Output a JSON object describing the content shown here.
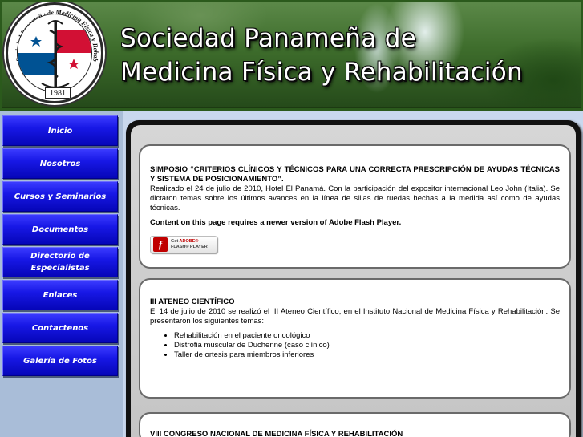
{
  "header": {
    "title_line1": "Sociedad Panameña de",
    "title_line2": "Medicina Física y Rehabilitación",
    "logo": {
      "ring_text": "Sociedad Panameña de Medicina Física y Rehabilitación",
      "year": "1981"
    }
  },
  "nav": {
    "items": [
      {
        "label": "Inicio"
      },
      {
        "label": "Nosotros"
      },
      {
        "label": "Cursos y Seminarios"
      },
      {
        "label": "Documentos"
      },
      {
        "label": "Directorio de Especialistas"
      },
      {
        "label": "Enlaces"
      },
      {
        "label": "Contactenos"
      },
      {
        "label": "Galería de Fotos"
      }
    ]
  },
  "content": {
    "news": [
      {
        "title": "SIMPOSIO “CRITERIOS CLÍNICOS Y TÉCNICOS PARA UNA CORRECTA PRESCRIPCIÓN DE AYUDAS TÉCNICAS Y SISTEMA DE POSICIONAMIENTO”.",
        "body": "Realizado el 24 de julio de 2010, Hotel El Panamá. Con la participación del expositor internacional Leo John (Italia). Se dictaron temas sobre los últimos avances en la línea de sillas de ruedas hechas a la medida así como de ayudas técnicas.",
        "flash_notice": "Content on this page requires a newer version of Adobe Flash Player.",
        "flash_badge": {
          "line1": "Get ",
          "brand": "ADOBE®",
          "line2": "FLASH® PLAYER"
        }
      },
      {
        "title": "III ATENEO CIENTÍFICO",
        "body": "El 14 de julio de 2010 se realizó el III Ateneo Científico, en el Instituto Nacional de Medicina Física y Rehabilitación. Se presentaron los siguientes temas:",
        "topics": [
          "Rehabilitación en el paciente oncológico",
          "Distrofia muscular de Duchenne (caso clínico)",
          "Taller de ortesis para miembros inferiores"
        ]
      },
      {
        "title": "VIII CONGRESO NACIONAL DE MEDICINA FÍSICA Y REHABILITACIÓN"
      }
    ]
  },
  "colors": {
    "nav_button": "#1818e6",
    "header_green": "#3e6d2c",
    "sidebar_bg": "#a9bdd8",
    "flag_red": "#d21034",
    "flag_blue": "#005293"
  }
}
